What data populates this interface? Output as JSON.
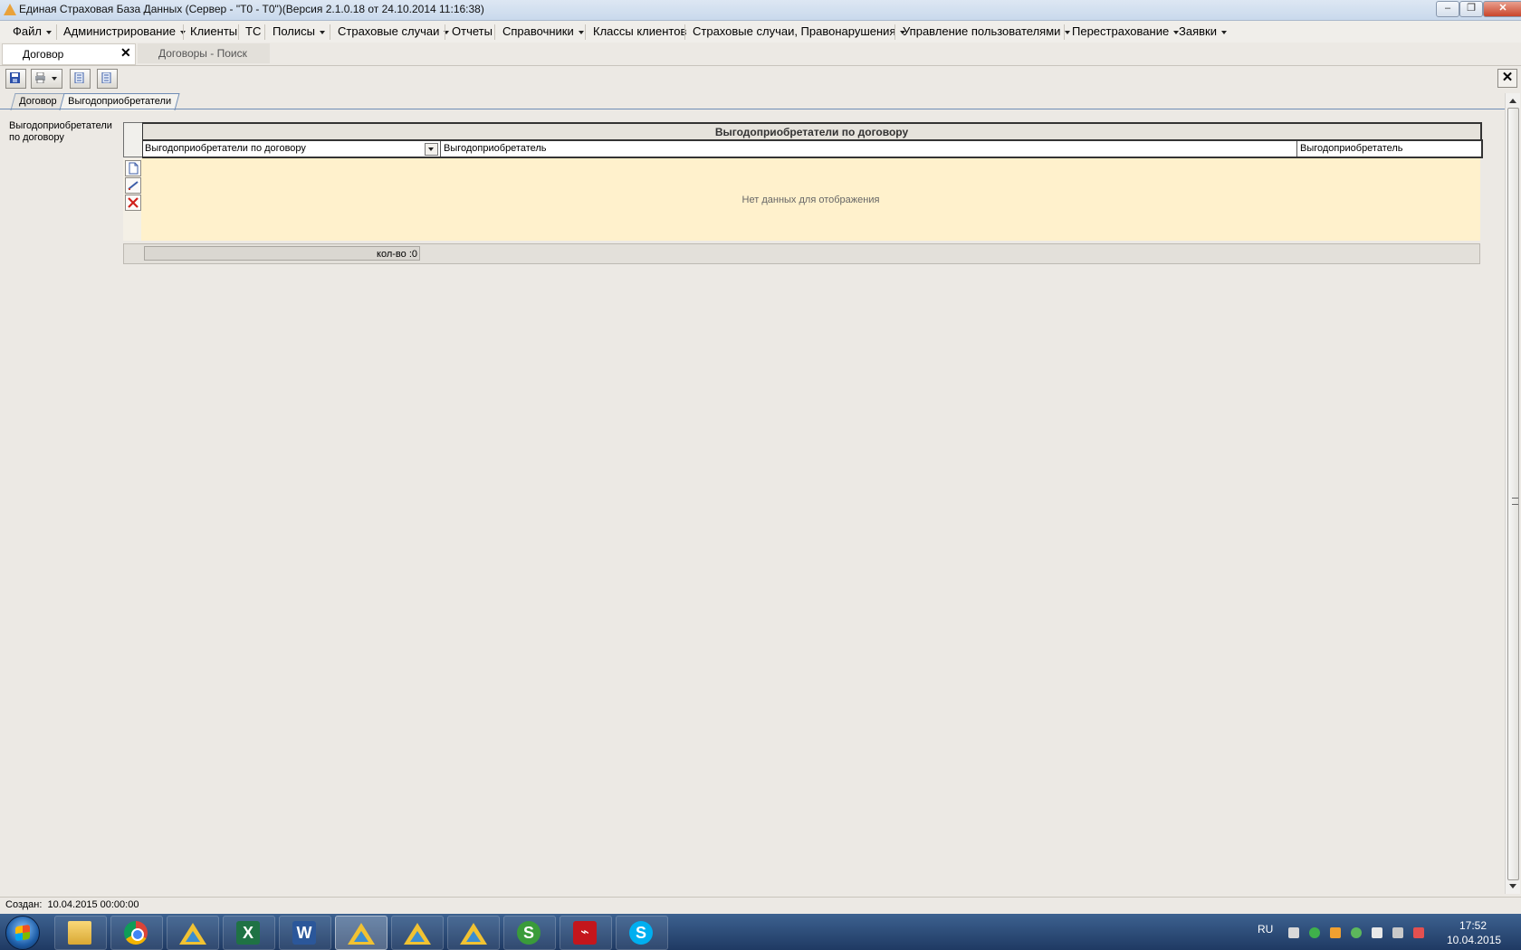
{
  "window": {
    "title": "Единая Страховая База Данных (Сервер - \"T0 - T0\")(Версия 2.1.0.18 от 24.10.2014 11:16:38)",
    "minimize": "–",
    "restore": "❐",
    "close": "✕"
  },
  "menu": [
    {
      "label": "Файл",
      "dropdown": true
    },
    {
      "label": "Администрирование",
      "dropdown": true
    },
    {
      "label": "Клиенты",
      "dropdown": false
    },
    {
      "label": "ТС",
      "dropdown": false
    },
    {
      "label": "Полисы",
      "dropdown": true
    },
    {
      "label": "Страховые случаи",
      "dropdown": true
    },
    {
      "label": "Отчеты",
      "dropdown": false
    },
    {
      "label": "Справочники",
      "dropdown": true
    },
    {
      "label": "Классы клиентов",
      "dropdown": false
    },
    {
      "label": "Страховые случаи, Правонарушения",
      "dropdown": true
    },
    {
      "label": "Управление пользователями",
      "dropdown": true
    },
    {
      "label": "Перестрахование",
      "dropdown": true
    },
    {
      "label": "Заявки",
      "dropdown": true
    }
  ],
  "doc_tabs": {
    "active": "Договор",
    "close": "✕",
    "second": "Договоры  -  Поиск"
  },
  "toolbar": {
    "close": "✕"
  },
  "inner_tabs": [
    "Договор",
    "Выгодоприобретатели"
  ],
  "left_label": "Выгодоприобретатели по договору",
  "grid": {
    "band": "Выгодоприобретатели по договору",
    "columns": [
      "Выгодоприобретатели по договору",
      "Выгодоприобретатель",
      "Выгодоприобретатель"
    ],
    "empty_text": "Нет данных для отображения",
    "count": "кол-во :0"
  },
  "status": {
    "created": "Создан:  10.04.2015 00:00:00"
  },
  "taskbar": {
    "lang": "RU",
    "time": "17:52",
    "date": "10.04.2015"
  },
  "colors": {
    "grid_empty_bg": "#FFF1CC",
    "window_bg": "#ECE9E4",
    "taskbar": "#2B4C7A"
  }
}
